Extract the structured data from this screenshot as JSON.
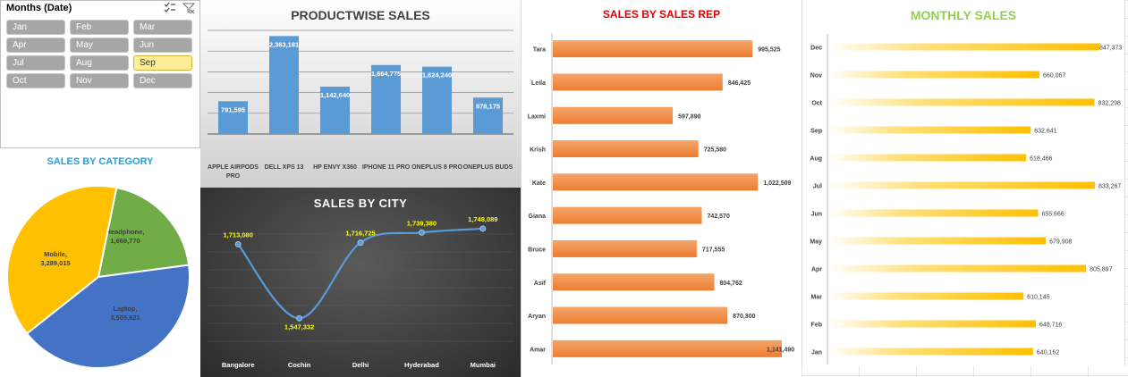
{
  "slicer": {
    "title": "Months (Date)",
    "months": [
      "Jan",
      "Feb",
      "Mar",
      "Apr",
      "May",
      "Jun",
      "Jul",
      "Aug",
      "Sep",
      "Oct",
      "Nov",
      "Dec"
    ],
    "selected": "Sep",
    "icons": [
      "multi-select-icon",
      "clear-filter-icon"
    ]
  },
  "category": {
    "title": "SALES BY CATEGORY",
    "chart_data": {
      "type": "pie",
      "title": "SALES BY CATEGORY",
      "slices": [
        {
          "label": "Headphone",
          "value": 1669770,
          "value_label": "1,669,770",
          "color": "#70ad47"
        },
        {
          "label": "Laptop",
          "value": 3505821,
          "value_label": "3,505,821",
          "color": "#4472c4"
        },
        {
          "label": "Mobile",
          "value": 3289015,
          "value_label": "3,289,015",
          "color": "#ffc000"
        }
      ]
    }
  },
  "product": {
    "title": "PRODUCTWISE SALES",
    "chart_data": {
      "type": "bar",
      "title": "PRODUCTWISE SALES",
      "categories": [
        "APPLE AIRPODS PRO",
        "DELL XPS 13",
        "HP ENVY X360",
        "IPHONE 11 PRO",
        "ONEPLUS 8 PRO",
        "ONEPLUS BUDS"
      ],
      "values": [
        791595,
        2363181,
        1142640,
        1664775,
        1624240,
        878175
      ],
      "labels": [
        "791,595",
        "2,363,181",
        "1,142,640",
        "1,664,775",
        "1,624,240",
        "878,175"
      ],
      "ylim": [
        0,
        2500000
      ],
      "bar_color": "#5b9bd5",
      "grid": true
    }
  },
  "city": {
    "title": "SALES BY CITY",
    "chart_data": {
      "type": "line",
      "title": "SALES BY CITY",
      "categories": [
        "Bangalore",
        "Cochin",
        "Delhi",
        "Hyderabad",
        "Mumbai"
      ],
      "values": [
        1713080,
        1547332,
        1716725,
        1739380,
        1748089
      ],
      "labels": [
        "1,713,080",
        "1,547,332",
        "1,716,725",
        "1,739,380",
        "1,748,089"
      ],
      "line_color": "#5b9bd5",
      "label_color": "#ffff00",
      "smooth": true
    }
  },
  "rep": {
    "title": "SALES BY SALES REP",
    "chart_data": {
      "type": "bar",
      "orientation": "horizontal",
      "title": "SALES BY SALES REP",
      "categories": [
        "Tara",
        "Leila",
        "Laxmi",
        "Krish",
        "Kate",
        "Giana",
        "Bruce",
        "Asif",
        "Aryan",
        "Amar"
      ],
      "values": [
        995525,
        846425,
        597890,
        725580,
        1022509,
        742570,
        717555,
        804762,
        870300,
        1141490
      ],
      "labels": [
        "995,525",
        "846,425",
        "597,890",
        "725,580",
        "1,022,509",
        "742,570",
        "717,555",
        "804,762",
        "870,300",
        "1,141,490"
      ],
      "bar_color": "#ed7d31",
      "title_color": "#e00000"
    }
  },
  "monthly": {
    "title": "MONTHLY SALES",
    "chart_data": {
      "type": "bar",
      "orientation": "horizontal",
      "title": "MONTHLY SALES",
      "categories": [
        "Dec",
        "Nov",
        "Oct",
        "Sep",
        "Aug",
        "Jul",
        "Jun",
        "May",
        "Apr",
        "Mar",
        "Feb",
        "Jan"
      ],
      "values": [
        847373,
        660067,
        832298,
        632641,
        618466,
        833267,
        655666,
        679908,
        805897,
        610145,
        648716,
        640162
      ],
      "labels": [
        "847,373",
        "660,067",
        "832,298",
        "632,641",
        "618,466",
        "833,267",
        "655,666",
        "679,908",
        "805,897",
        "610,145",
        "648,716",
        "640,162"
      ],
      "bar_color": "#ffc000",
      "title_color": "#92d050"
    }
  }
}
